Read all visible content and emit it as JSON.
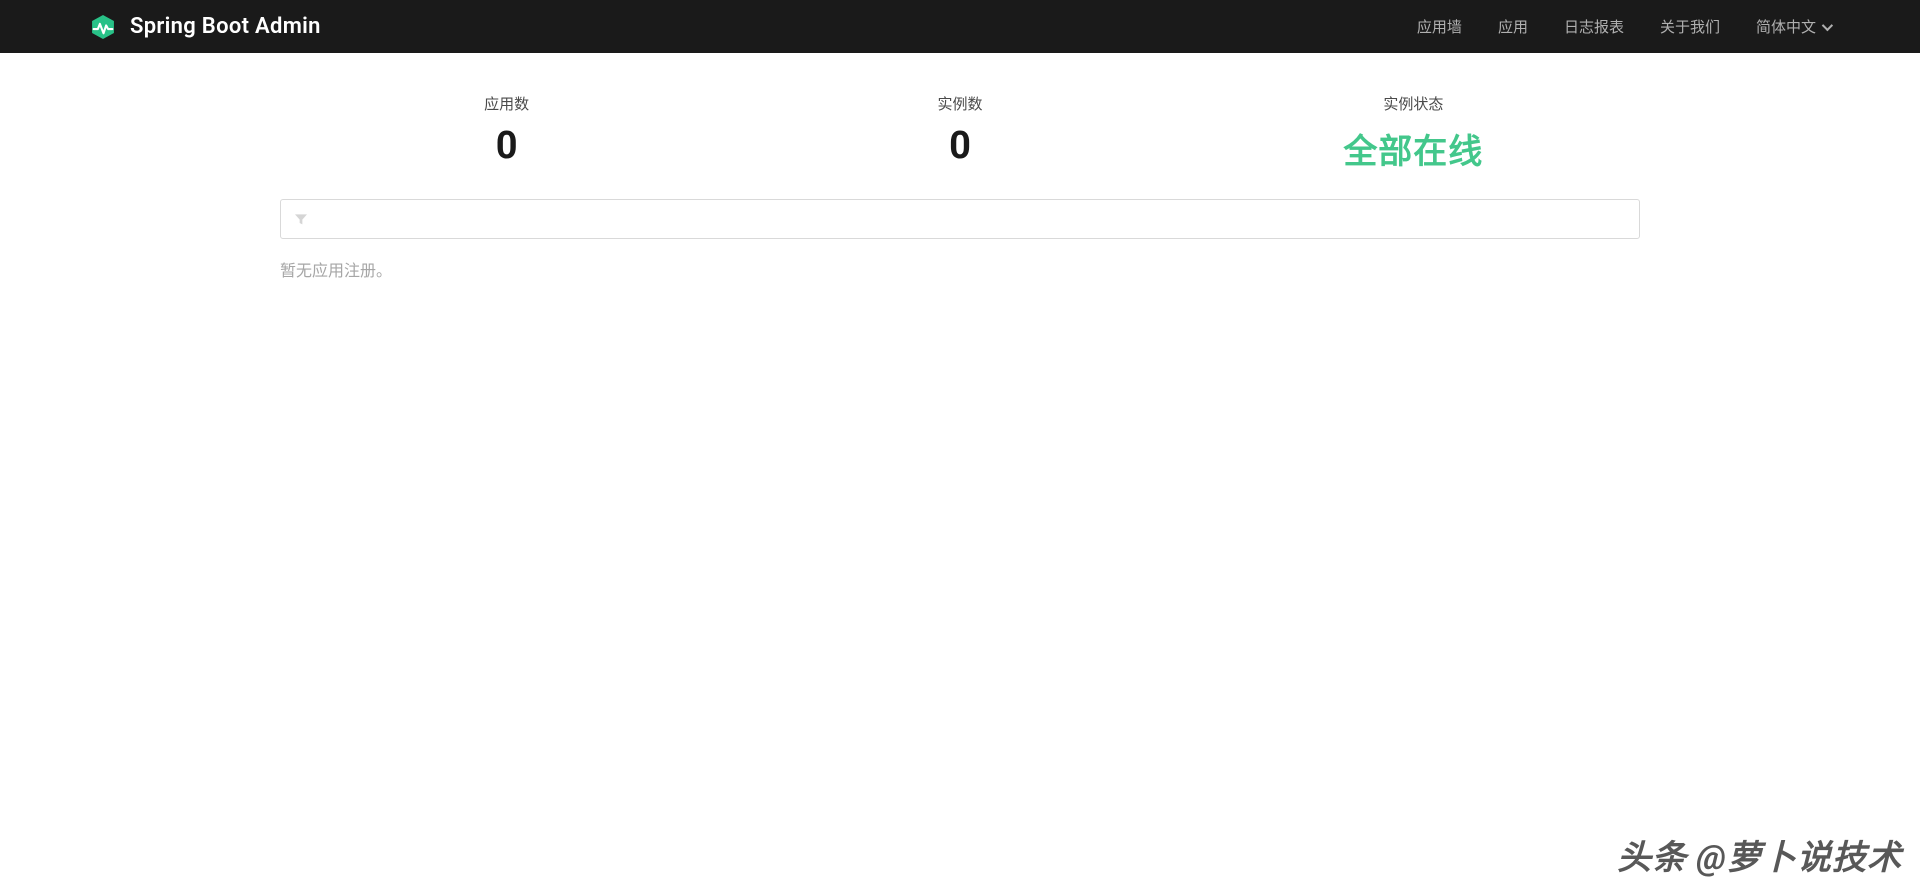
{
  "header": {
    "title": "Spring Boot Admin",
    "nav": [
      {
        "label": "应用墙"
      },
      {
        "label": "应用"
      },
      {
        "label": "日志报表"
      },
      {
        "label": "关于我们"
      },
      {
        "label": "简体中文",
        "dropdown": true
      }
    ]
  },
  "stats": {
    "apps": {
      "label": "应用数",
      "value": "0"
    },
    "instances": {
      "label": "实例数",
      "value": "0"
    },
    "status": {
      "label": "实例状态",
      "value": "全部在线"
    }
  },
  "filter": {
    "placeholder": ""
  },
  "empty_message": "暂无应用注册。",
  "watermark": "头条 @萝卜说技术"
}
